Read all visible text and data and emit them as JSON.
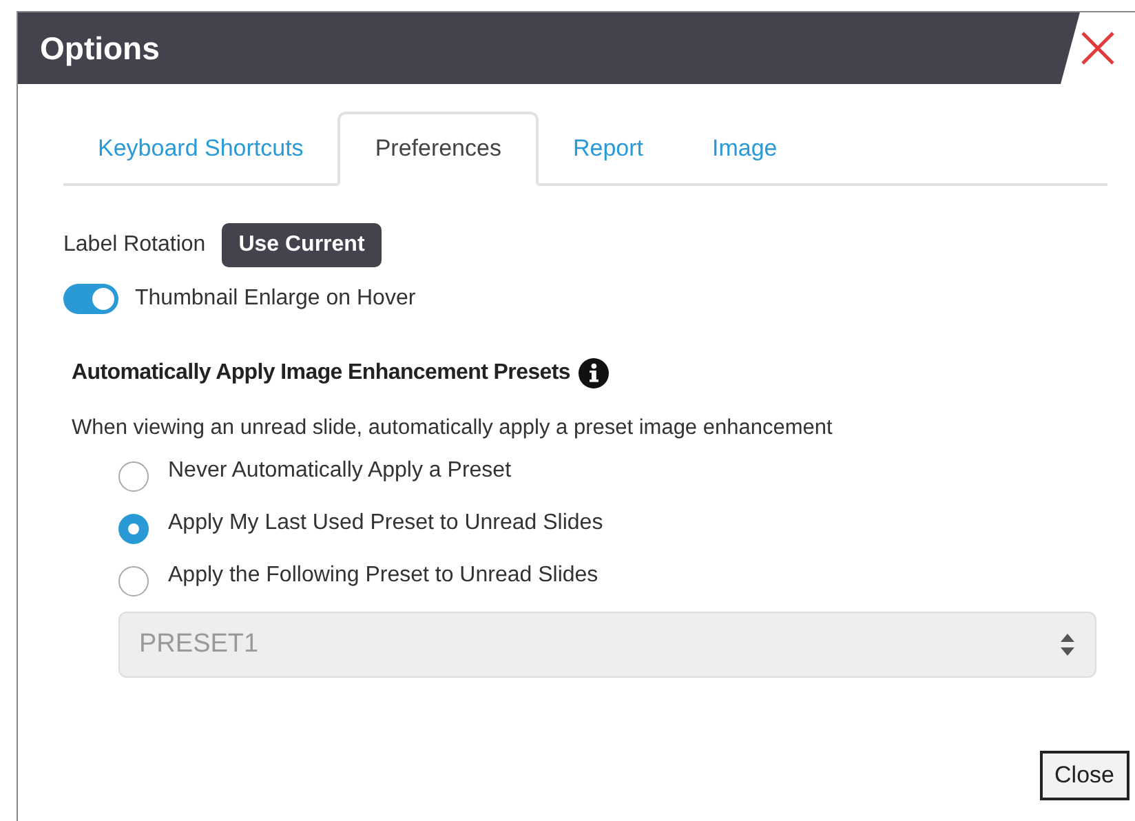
{
  "window": {
    "title": "Options"
  },
  "tabs": [
    {
      "label": "Keyboard Shortcuts",
      "selected": false
    },
    {
      "label": "Preferences",
      "selected": true
    },
    {
      "label": "Report",
      "selected": false
    },
    {
      "label": "Image",
      "selected": false
    }
  ],
  "label_rotation": {
    "label": "Label Rotation",
    "button": "Use Current"
  },
  "toggle": {
    "label": "Thumbnail Enlarge on Hover",
    "on": true
  },
  "presets": {
    "heading": "Automatically Apply Image Enhancement Presets",
    "description": "When viewing an unread slide, automatically apply a preset image enhancement",
    "options": [
      {
        "label": "Never Automatically Apply a Preset",
        "selected": false
      },
      {
        "label": "Apply My Last Used Preset to Unread Slides",
        "selected": true
      },
      {
        "label": "Apply the Following Preset to Unread Slides",
        "selected": false
      }
    ],
    "select": {
      "value": "PRESET1",
      "disabled": true
    }
  },
  "buttons": [
    "Close"
  ]
}
